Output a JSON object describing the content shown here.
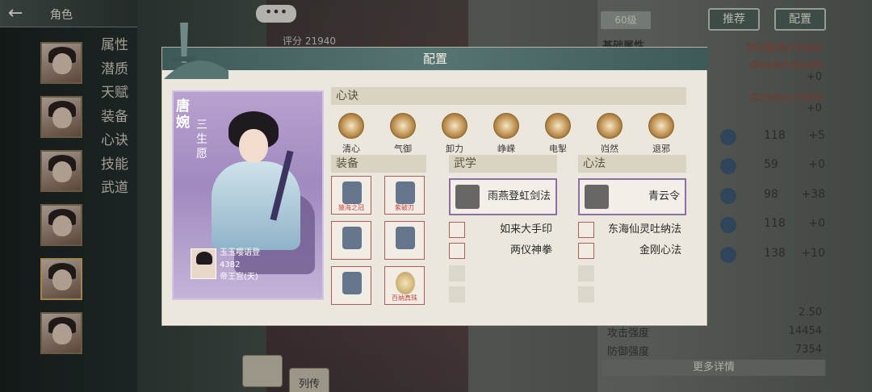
{
  "header": {
    "back_label": "角色"
  },
  "sidebar_menu": [
    "属性",
    "潜质",
    "天赋",
    "装备",
    "心诀",
    "技能",
    "武道"
  ],
  "topbar": {
    "level": "60级",
    "recommend": "推荐",
    "config": "配置"
  },
  "bubble": "•••",
  "score": "评分 21940",
  "right_panel": {
    "base_attr": "基础属性",
    "power_label": "神功盖世(21940)",
    "hp": "总94465/94465",
    "hp_plus": "+0",
    "mp": "总25850/25850",
    "mp_plus": "+0",
    "stats": [
      {
        "val": "118",
        "plus": "+5"
      },
      {
        "val": "59",
        "plus": "+0"
      },
      {
        "val": "98",
        "plus": "+38"
      },
      {
        "val": "118",
        "plus": "+0"
      },
      {
        "val": "138",
        "plus": "+10"
      }
    ],
    "val_250": "2.50",
    "atk_label": "攻击强度",
    "atk_val": "14454",
    "def_label": "防御强度",
    "def_val": "7354",
    "more": "更多详情"
  },
  "bottom": {
    "btn2": "列传"
  },
  "modal": {
    "title": "配置",
    "card": {
      "name": "唐婉",
      "subtitle": "三生愿",
      "owner_name": "玉玉嘤语登",
      "owner_id": "4382",
      "owner_server": "帝王宫(天)"
    },
    "xinjue_label": "心诀",
    "xinjue": [
      "清心",
      "气御",
      "卸力",
      "峥嵘",
      "电掣",
      "岿然",
      "退邪"
    ],
    "equip_label": "装备",
    "equipment": [
      "猿海之冠",
      "紫破刃",
      "",
      "",
      "",
      "百纳真珠"
    ],
    "wuxue_label": "武学",
    "wuxue_main": "雨燕登虹剑法",
    "wuxue_list": [
      "如来大手印",
      "两仪神拳"
    ],
    "xinfa_label": "心法",
    "xinfa_main": "青云令",
    "xinfa_list": [
      "东海仙灵吐纳法",
      "金刚心法"
    ]
  },
  "colors": {
    "modal_header": "#4a6664",
    "card_bg": "#a791c4",
    "equip_border": "#b25d5a",
    "selected_border": "#8d6fa8"
  }
}
